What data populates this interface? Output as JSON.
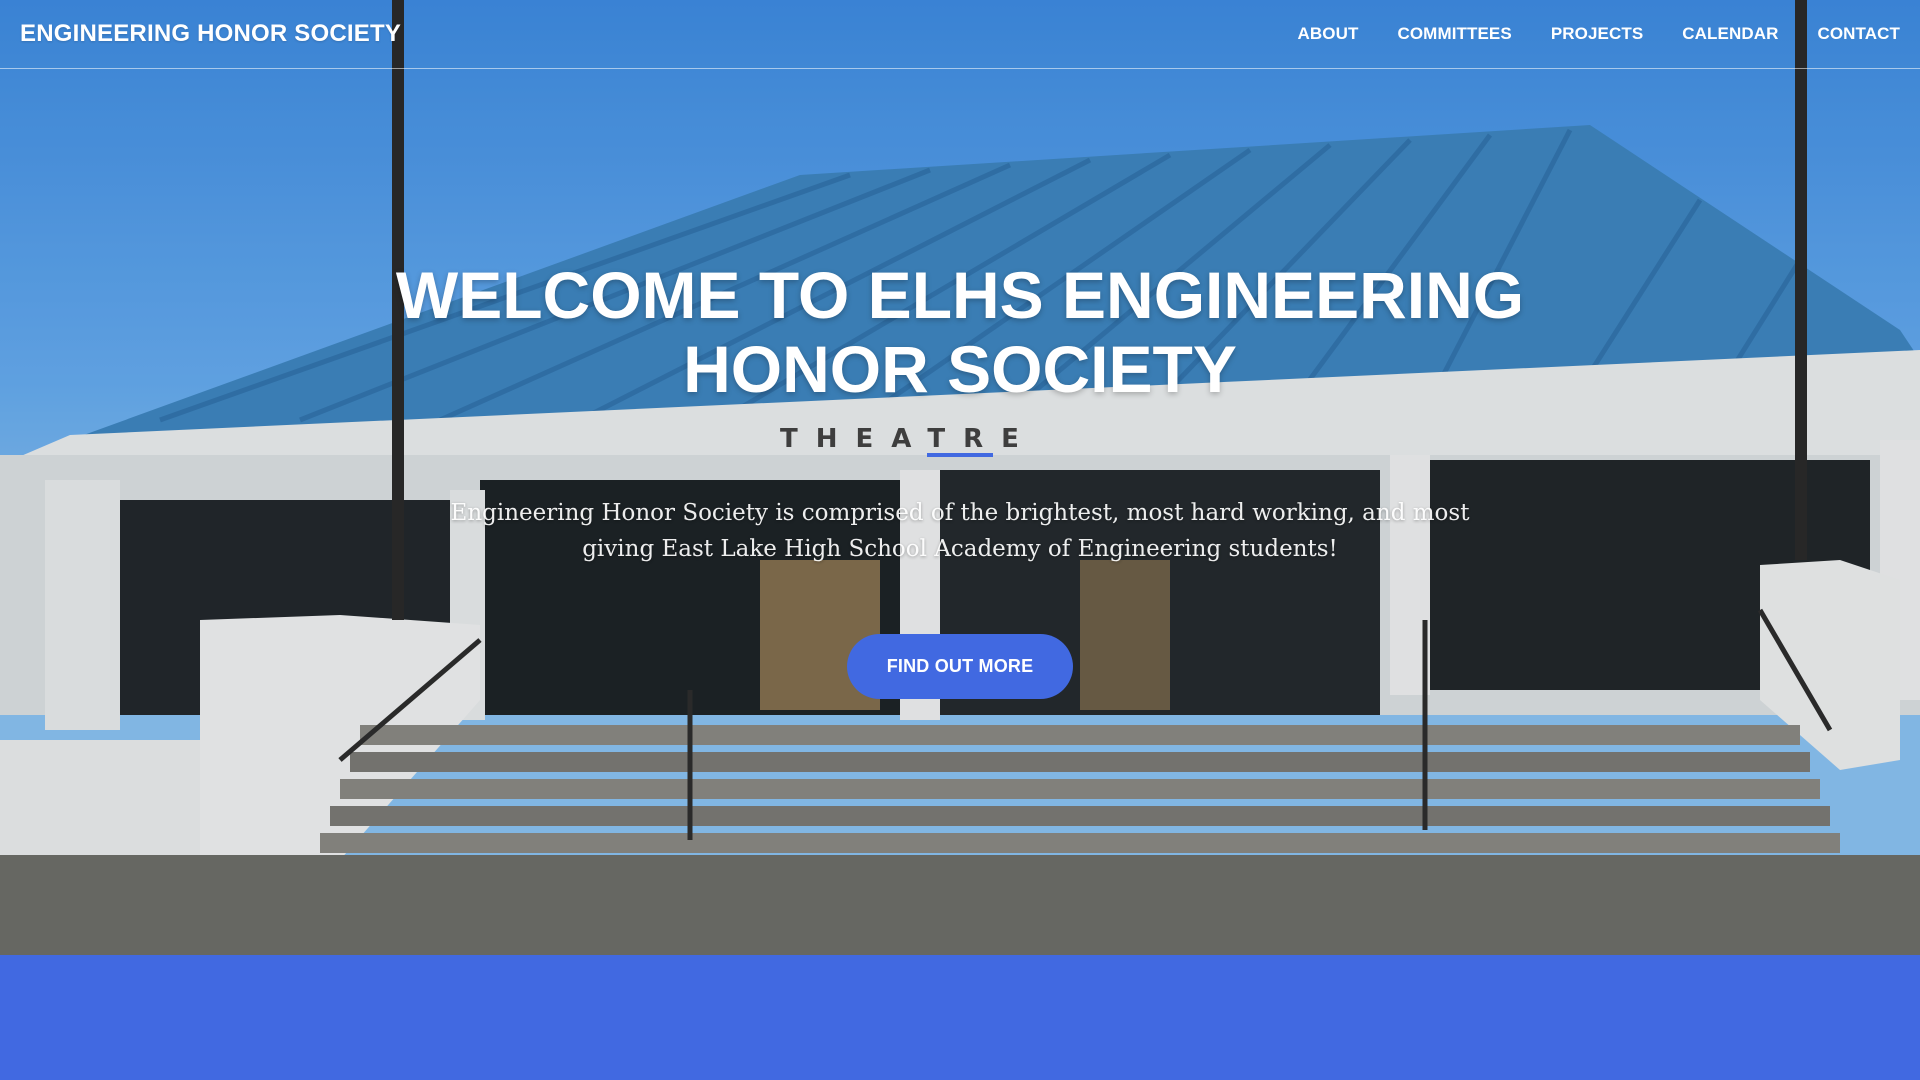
{
  "navbar": {
    "brand": "ENGINEERING HONOR SOCIETY",
    "items": [
      {
        "label": "ABOUT"
      },
      {
        "label": "COMMITTEES"
      },
      {
        "label": "PROJECTS"
      },
      {
        "label": "CALENDAR"
      },
      {
        "label": "CONTACT"
      }
    ]
  },
  "hero": {
    "title": "WELCOME TO ELHS ENGINEERING HONOR SOCIETY",
    "lead": "Engineering Honor Society is comprised of the brightest, most hard working, and most giving East Lake High School Academy of Engineering students!",
    "cta_label": "FIND OUT MORE",
    "building_sign": "THEATRE"
  },
  "colors": {
    "accent": "#4169e1",
    "sky": "#5aa3ef",
    "text": "#ffffff"
  }
}
